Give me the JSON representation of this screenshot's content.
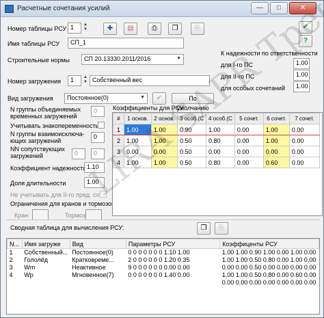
{
  "window": {
    "title": "Расчетные сочетания усилий"
  },
  "header": {
    "table_number_label": "Номер таблицы РСУ",
    "table_number_value": "1",
    "table_name_label": "Имя таблицы РСУ",
    "table_name_value": "СП_1",
    "norms_label": "Строительные нормы",
    "norms_value": "СП 20.13330.2011/2016",
    "load_number_label": "Номер загружения",
    "load_number_value": "1",
    "load_name_value": "Собственный вес"
  },
  "reliability": {
    "heading": "К надежности по ответственности",
    "rows": [
      {
        "label": "для I-го ПС",
        "value": "1.00"
      },
      {
        "label": "для II-го ПС",
        "value": "1.00"
      },
      {
        "label": "для особых сочетаний",
        "value": "1.00"
      }
    ]
  },
  "load_type": {
    "label": "Вид загружения",
    "value": "Постоянное(0)",
    "default_button": "По умолчанию"
  },
  "left_params": {
    "n_groups_label": "N группы объединяемых временных загружений",
    "n_groups_value": "0",
    "sign_label": "Учитывать знакопеременность",
    "n_mutual_label": "N группы взаимоисключа-ющих загружений",
    "n_mutual_value": "0",
    "nn_label": "NN сопутствующих загружений",
    "nn_value1": "0",
    "nn_value2": "0",
    "reliability_coef_label": "Коэффициент надежности",
    "reliability_coef_value": "1.10",
    "duration_label": "Доля длительности",
    "duration_value": "1.00",
    "no_second_label": "Не учитывать для II-го пред. сост.",
    "crane_label": "Ограничения для кранов и тормозов",
    "crane_label_short": "Кран",
    "brake_label": "Тормоз"
  },
  "coef_grid": {
    "title": "Коэффициенты для РСУ",
    "columns": [
      "#",
      "1 основ.",
      "2 основ.",
      "3 особ.(С",
      "4 особ.(С",
      "5 сочет.",
      "6 сочет.",
      "7 сочет."
    ],
    "rows": [
      {
        "n": "1",
        "cells": [
          "1.00",
          "1.00",
          "0.90",
          "1.00",
          "0.00",
          "1.00",
          "0.00"
        ]
      },
      {
        "n": "2",
        "cells": [
          "1.00",
          "1.00",
          "0.50",
          "0.80",
          "0.00",
          "1.00",
          "0.00"
        ]
      },
      {
        "n": "3",
        "cells": [
          "0.00",
          "0.00",
          "0.50",
          "0.00",
          "0.00",
          "0.00",
          "0.00"
        ]
      },
      {
        "n": "4",
        "cells": [
          "1.00",
          "1.00",
          "0.50",
          "0.80",
          "0.00",
          "0.60",
          "0.00"
        ]
      }
    ]
  },
  "summary": {
    "title": "Сводная таблица для вычисления РСУ:",
    "columns": [
      "N...",
      "Имя загруже",
      "Вид",
      "Параметры РСУ",
      "Коэффиценты РСУ"
    ],
    "rows": [
      {
        "n": "1",
        "name": "Собственный...",
        "type": "Постоянное(0)",
        "params": "0 0 0 0 0 0 0 1.10 1.00",
        "coefs": "1.00 1.00 0.90 1.00 0.00 1.00 0.00"
      },
      {
        "n": "2",
        "name": "Гололёд",
        "type": "Кратковреме...",
        "params": "2 0 0 0 0 0 0 1.20 0.35",
        "coefs": "1.00 1.00 0.50 0.80 0.00 1.00 0.00"
      },
      {
        "n": "3",
        "name": "Wm",
        "type": "Неактивное",
        "params": "9 0 0 0 0 0 0 0.00 0.00",
        "coefs": "0.00 0.00 0.50 0.00 0.00 0.00 0.00"
      },
      {
        "n": "4",
        "name": "Wp",
        "type": "Мгновенное(7)",
        "params": "0 0 0 0 0 0 0 1.40 0.00",
        "coefs": "1.00 1.00 0.50 0.80 0.00 0.60 0.00"
      },
      {
        "n": "",
        "name": "",
        "type": "",
        "params": "",
        "coefs": "0.00 0.00 0.00 0.00 0.00 0.00 0.00"
      }
    ]
  },
  "watermark": "LIRA SAPR Тренинг"
}
